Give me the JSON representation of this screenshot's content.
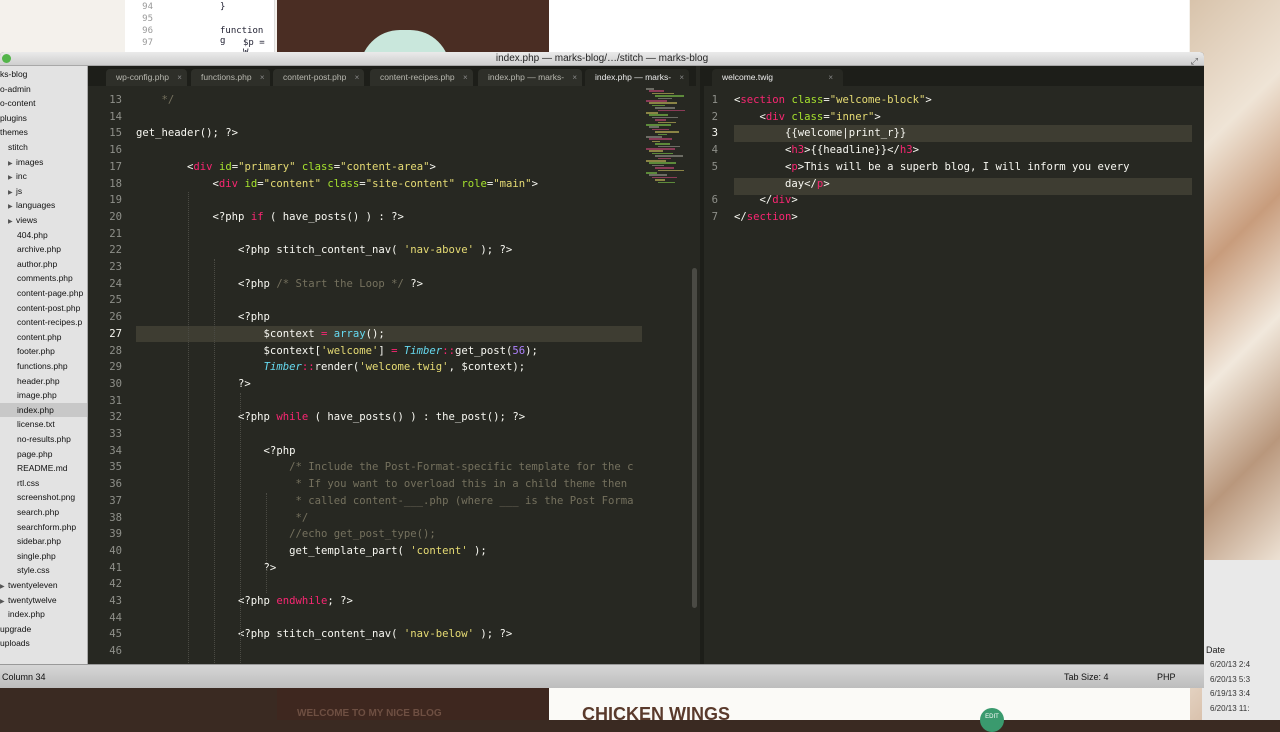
{
  "background": {
    "top_code": [
      {
        "ln": "94",
        "text": "}"
      },
      {
        "ln": "95",
        "text": ""
      },
      {
        "ln": "96",
        "text": "function g"
      },
      {
        "ln": "97",
        "text": "$p = W"
      }
    ],
    "blog_banner": "WELCOME TO MY NICE BLOG",
    "post_title": "CHICKEN WINGS",
    "edit_label": "EDIT",
    "panel_date_header": "Date",
    "panel_dates": [
      "6/20/13 2:4",
      "6/20/13 5:3",
      "6/19/13 3:4",
      "6/20/13 11:"
    ]
  },
  "window": {
    "title": "index.php — marks-blog/…/stitch — marks-blog"
  },
  "sidebar": {
    "items": [
      {
        "label": "ks-blog",
        "indent": 0,
        "tri": ""
      },
      {
        "label": "o-admin",
        "indent": 0,
        "tri": ""
      },
      {
        "label": "o-content",
        "indent": 0,
        "tri": ""
      },
      {
        "label": "plugins",
        "indent": 0,
        "tri": ""
      },
      {
        "label": "themes",
        "indent": 0,
        "tri": ""
      },
      {
        "label": "stitch",
        "indent": 8,
        "tri": ""
      },
      {
        "label": "images",
        "indent": 8,
        "tri": "▶"
      },
      {
        "label": "inc",
        "indent": 8,
        "tri": "▶"
      },
      {
        "label": "js",
        "indent": 8,
        "tri": "▶"
      },
      {
        "label": "languages",
        "indent": 8,
        "tri": "▶"
      },
      {
        "label": "views",
        "indent": 8,
        "tri": "▶"
      },
      {
        "label": "404.php",
        "indent": 17,
        "tri": ""
      },
      {
        "label": "archive.php",
        "indent": 17,
        "tri": ""
      },
      {
        "label": "author.php",
        "indent": 17,
        "tri": ""
      },
      {
        "label": "comments.php",
        "indent": 17,
        "tri": ""
      },
      {
        "label": "content-page.php",
        "indent": 17,
        "tri": ""
      },
      {
        "label": "content-post.php",
        "indent": 17,
        "tri": ""
      },
      {
        "label": "content-recipes.p",
        "indent": 17,
        "tri": ""
      },
      {
        "label": "content.php",
        "indent": 17,
        "tri": ""
      },
      {
        "label": "footer.php",
        "indent": 17,
        "tri": ""
      },
      {
        "label": "functions.php",
        "indent": 17,
        "tri": ""
      },
      {
        "label": "header.php",
        "indent": 17,
        "tri": ""
      },
      {
        "label": "image.php",
        "indent": 17,
        "tri": ""
      },
      {
        "label": "index.php",
        "indent": 17,
        "tri": "",
        "selected": true
      },
      {
        "label": "license.txt",
        "indent": 17,
        "tri": ""
      },
      {
        "label": "no-results.php",
        "indent": 17,
        "tri": ""
      },
      {
        "label": "page.php",
        "indent": 17,
        "tri": ""
      },
      {
        "label": "README.md",
        "indent": 17,
        "tri": ""
      },
      {
        "label": "rtl.css",
        "indent": 17,
        "tri": ""
      },
      {
        "label": "screenshot.png",
        "indent": 17,
        "tri": ""
      },
      {
        "label": "search.php",
        "indent": 17,
        "tri": ""
      },
      {
        "label": "searchform.php",
        "indent": 17,
        "tri": ""
      },
      {
        "label": "sidebar.php",
        "indent": 17,
        "tri": ""
      },
      {
        "label": "single.php",
        "indent": 17,
        "tri": ""
      },
      {
        "label": "style.css",
        "indent": 17,
        "tri": ""
      },
      {
        "label": "twentyeleven",
        "indent": 0,
        "tri": "▶"
      },
      {
        "label": "twentytwelve",
        "indent": 0,
        "tri": "▶"
      },
      {
        "label": "index.php",
        "indent": 8,
        "tri": ""
      },
      {
        "label": "upgrade",
        "indent": 0,
        "tri": ""
      },
      {
        "label": "uploads",
        "indent": 0,
        "tri": ""
      }
    ]
  },
  "tabs_left": [
    {
      "label": "wp-config.php",
      "active": false
    },
    {
      "label": "functions.php",
      "active": false
    },
    {
      "label": "content-post.php",
      "active": false
    },
    {
      "label": "content-recipes.php",
      "active": false
    },
    {
      "label": "index.php — marks-",
      "active": false
    },
    {
      "label": "index.php — marks-",
      "active": true
    }
  ],
  "tabs_right": [
    {
      "label": "welcome.twig",
      "active": true
    }
  ],
  "editor_left": {
    "current_line": 27,
    "lines": [
      {
        "n": "13",
        "segs": [
          {
            "t": "    */",
            "c": "com"
          }
        ]
      },
      {
        "n": "14",
        "segs": []
      },
      {
        "n": "15",
        "segs": [
          {
            "t": "get_header(); ?>",
            "c": ""
          }
        ]
      },
      {
        "n": "16",
        "segs": []
      },
      {
        "n": "17",
        "segs": [
          {
            "t": "        <",
            "c": ""
          },
          {
            "t": "div",
            "c": "kw"
          },
          {
            "t": " ",
            "c": ""
          },
          {
            "t": "id",
            "c": "attr"
          },
          {
            "t": "=",
            "c": ""
          },
          {
            "t": "\"primary\"",
            "c": "str"
          },
          {
            "t": " ",
            "c": ""
          },
          {
            "t": "class",
            "c": "attr"
          },
          {
            "t": "=",
            "c": ""
          },
          {
            "t": "\"content-area\"",
            "c": "str"
          },
          {
            "t": ">",
            "c": ""
          }
        ]
      },
      {
        "n": "18",
        "segs": [
          {
            "t": "            <",
            "c": ""
          },
          {
            "t": "div",
            "c": "kw"
          },
          {
            "t": " ",
            "c": ""
          },
          {
            "t": "id",
            "c": "attr"
          },
          {
            "t": "=",
            "c": ""
          },
          {
            "t": "\"content\"",
            "c": "str"
          },
          {
            "t": " ",
            "c": ""
          },
          {
            "t": "class",
            "c": "attr"
          },
          {
            "t": "=",
            "c": ""
          },
          {
            "t": "\"site-content\"",
            "c": "str"
          },
          {
            "t": " ",
            "c": ""
          },
          {
            "t": "role",
            "c": "attr"
          },
          {
            "t": "=",
            "c": ""
          },
          {
            "t": "\"main\"",
            "c": "str"
          },
          {
            "t": ">",
            "c": ""
          }
        ]
      },
      {
        "n": "19",
        "segs": []
      },
      {
        "n": "20",
        "segs": [
          {
            "t": "            <?php ",
            "c": ""
          },
          {
            "t": "if",
            "c": "kw"
          },
          {
            "t": " ( have_posts() ) : ?>",
            "c": ""
          }
        ]
      },
      {
        "n": "21",
        "segs": []
      },
      {
        "n": "22",
        "segs": [
          {
            "t": "                <?php stitch_content_nav( ",
            "c": ""
          },
          {
            "t": "'nav-above'",
            "c": "str"
          },
          {
            "t": " ); ?>",
            "c": ""
          }
        ]
      },
      {
        "n": "23",
        "segs": []
      },
      {
        "n": "24",
        "segs": [
          {
            "t": "                <?php ",
            "c": ""
          },
          {
            "t": "/* Start the Loop */",
            "c": "com"
          },
          {
            "t": " ?>",
            "c": ""
          }
        ]
      },
      {
        "n": "25",
        "segs": []
      },
      {
        "n": "26",
        "segs": [
          {
            "t": "                <?php",
            "c": ""
          }
        ]
      },
      {
        "n": "27",
        "segs": [
          {
            "t": "                    $context ",
            "c": ""
          },
          {
            "t": "=",
            "c": "kw"
          },
          {
            "t": " ",
            "c": ""
          },
          {
            "t": "array",
            "c": "fn"
          },
          {
            "t": "();",
            "c": ""
          }
        ]
      },
      {
        "n": "28",
        "segs": [
          {
            "t": "                    $context[",
            "c": ""
          },
          {
            "t": "'welcome'",
            "c": "str"
          },
          {
            "t": "] ",
            "c": ""
          },
          {
            "t": "=",
            "c": "kw"
          },
          {
            "t": " ",
            "c": ""
          },
          {
            "t": "Timber",
            "c": "cls"
          },
          {
            "t": "::",
            "c": "kw"
          },
          {
            "t": "get_post(",
            "c": ""
          },
          {
            "t": "56",
            "c": "num"
          },
          {
            "t": ");",
            "c": ""
          }
        ]
      },
      {
        "n": "29",
        "segs": [
          {
            "t": "                    ",
            "c": ""
          },
          {
            "t": "Timber",
            "c": "cls"
          },
          {
            "t": "::",
            "c": "kw"
          },
          {
            "t": "render(",
            "c": ""
          },
          {
            "t": "'welcome.twig'",
            "c": "str"
          },
          {
            "t": ", $context);",
            "c": ""
          }
        ]
      },
      {
        "n": "30",
        "segs": [
          {
            "t": "                ?>",
            "c": ""
          }
        ]
      },
      {
        "n": "31",
        "segs": []
      },
      {
        "n": "32",
        "segs": [
          {
            "t": "                <?php ",
            "c": ""
          },
          {
            "t": "while",
            "c": "kw"
          },
          {
            "t": " ( have_posts() ) : the_post(); ?>",
            "c": ""
          }
        ]
      },
      {
        "n": "33",
        "segs": []
      },
      {
        "n": "34",
        "segs": [
          {
            "t": "                    <?php",
            "c": ""
          }
        ]
      },
      {
        "n": "35",
        "segs": [
          {
            "t": "                        /* Include the Post-Format-specific template for the c",
            "c": "com"
          }
        ]
      },
      {
        "n": "36",
        "segs": [
          {
            "t": "                         * If you want to overload this in a child theme then",
            "c": "com"
          }
        ]
      },
      {
        "n": "37",
        "segs": [
          {
            "t": "                         * called content-___.php (where ___ is the Post Forma",
            "c": "com"
          }
        ]
      },
      {
        "n": "38",
        "segs": [
          {
            "t": "                         */",
            "c": "com"
          }
        ]
      },
      {
        "n": "39",
        "segs": [
          {
            "t": "                        //echo get_post_type();",
            "c": "com"
          }
        ]
      },
      {
        "n": "40",
        "segs": [
          {
            "t": "                        get_template_part( ",
            "c": ""
          },
          {
            "t": "'content'",
            "c": "str"
          },
          {
            "t": " );",
            "c": ""
          }
        ]
      },
      {
        "n": "41",
        "segs": [
          {
            "t": "                    ?>",
            "c": ""
          }
        ]
      },
      {
        "n": "42",
        "segs": []
      },
      {
        "n": "43",
        "segs": [
          {
            "t": "                <?php ",
            "c": ""
          },
          {
            "t": "endwhile",
            "c": "kw"
          },
          {
            "t": "; ?>",
            "c": ""
          }
        ]
      },
      {
        "n": "44",
        "segs": []
      },
      {
        "n": "45",
        "segs": [
          {
            "t": "                <?php stitch_content_nav( ",
            "c": ""
          },
          {
            "t": "'nav-below'",
            "c": "str"
          },
          {
            "t": " ); ?>",
            "c": ""
          }
        ]
      },
      {
        "n": "46",
        "segs": []
      }
    ]
  },
  "editor_right": {
    "current_line": 3,
    "lines": [
      {
        "n": "1",
        "segs": [
          {
            "t": "<",
            "c": ""
          },
          {
            "t": "section",
            "c": "kw"
          },
          {
            "t": " ",
            "c": ""
          },
          {
            "t": "class",
            "c": "attr"
          },
          {
            "t": "=",
            "c": ""
          },
          {
            "t": "\"welcome-block\"",
            "c": "str"
          },
          {
            "t": ">",
            "c": ""
          }
        ]
      },
      {
        "n": "2",
        "segs": [
          {
            "t": "    <",
            "c": ""
          },
          {
            "t": "div",
            "c": "kw"
          },
          {
            "t": " ",
            "c": ""
          },
          {
            "t": "class",
            "c": "attr"
          },
          {
            "t": "=",
            "c": ""
          },
          {
            "t": "\"inner\"",
            "c": "str"
          },
          {
            "t": ">",
            "c": ""
          }
        ]
      },
      {
        "n": "3",
        "segs": [
          {
            "t": "        {{welcome|print_r}}",
            "c": ""
          }
        ]
      },
      {
        "n": "4",
        "segs": [
          {
            "t": "        <",
            "c": ""
          },
          {
            "t": "h3",
            "c": "kw"
          },
          {
            "t": ">{{headline}}</",
            "c": ""
          },
          {
            "t": "h3",
            "c": "kw"
          },
          {
            "t": ">",
            "c": ""
          }
        ]
      },
      {
        "n": "5",
        "segs": [
          {
            "t": "        <",
            "c": ""
          },
          {
            "t": "p",
            "c": "kw"
          },
          {
            "t": ">This will be a superb blog, I will inform you every",
            "c": ""
          }
        ]
      },
      {
        "n": "",
        "segs": [
          {
            "t": "        day</",
            "c": ""
          },
          {
            "t": "p",
            "c": "kw"
          },
          {
            "t": ">",
            "c": ""
          }
        ]
      },
      {
        "n": "6",
        "segs": [
          {
            "t": "    </",
            "c": ""
          },
          {
            "t": "div",
            "c": "kw"
          },
          {
            "t": ">",
            "c": ""
          }
        ]
      },
      {
        "n": "7",
        "segs": [
          {
            "t": "</",
            "c": ""
          },
          {
            "t": "section",
            "c": "kw"
          },
          {
            "t": ">",
            "c": ""
          }
        ]
      }
    ]
  },
  "status": {
    "position": "Column 34",
    "tab_size": "Tab Size: 4",
    "syntax": "PHP"
  }
}
